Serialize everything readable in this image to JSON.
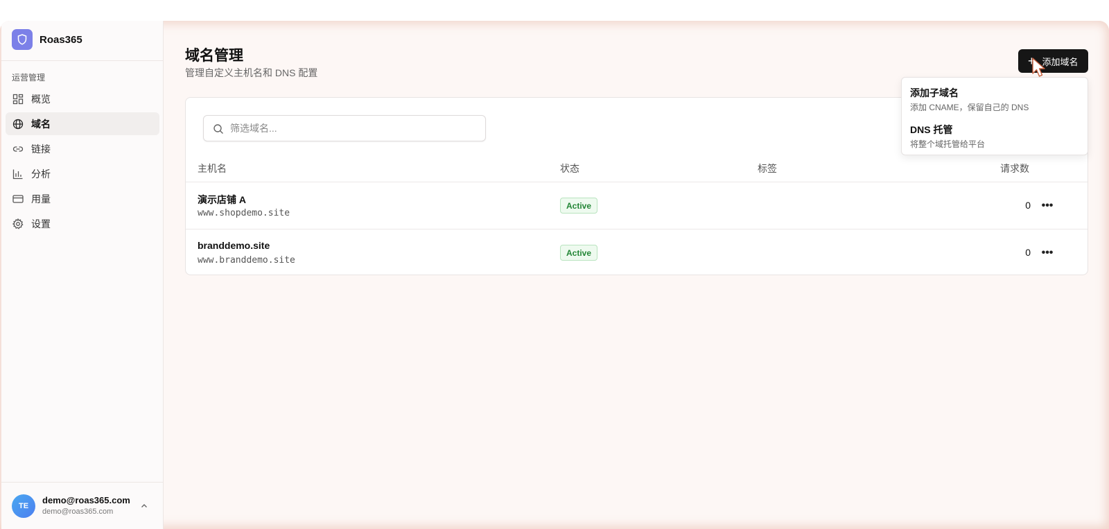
{
  "app": {
    "name": "Roas365",
    "logo_icon": "shield-icon",
    "accent": "#7c80e8"
  },
  "sidebar": {
    "section_label": "运营管理",
    "items": [
      {
        "label": "概览",
        "icon": "dashboard-icon"
      },
      {
        "label": "域名",
        "icon": "globe-icon",
        "active": true
      },
      {
        "label": "链接",
        "icon": "link-icon"
      },
      {
        "label": "分析",
        "icon": "bar-chart-icon"
      },
      {
        "label": "用量",
        "icon": "credit-card-icon"
      },
      {
        "label": "设置",
        "icon": "gear-icon"
      }
    ]
  },
  "user": {
    "initials": "TE",
    "name": "demo@roas365.com",
    "email": "demo@roas365.com"
  },
  "page": {
    "title": "域名管理",
    "subtitle": "管理自定义主机名和 DNS 配置"
  },
  "add_button": {
    "label": "添加域名"
  },
  "dropdown": {
    "items": [
      {
        "title": "添加子域名",
        "desc": "添加 CNAME，保留自己的 DNS"
      },
      {
        "title": "DNS 托管",
        "desc": "将整个域托管给平台"
      }
    ]
  },
  "search": {
    "placeholder": "筛选域名..."
  },
  "table": {
    "headers": {
      "hostname": "主机名",
      "status": "状态",
      "tags": "标签",
      "requests": "请求数"
    },
    "rows": [
      {
        "name": "演示店铺 A",
        "host": "www.shopdemo.site",
        "status": "Active",
        "requests": "0"
      },
      {
        "name": "branddemo.site",
        "host": "www.branddemo.site",
        "status": "Active",
        "requests": "0"
      }
    ]
  },
  "colors": {
    "status_active_text": "#238636",
    "status_active_bg": "#eefaef",
    "button_bg": "#161616"
  }
}
